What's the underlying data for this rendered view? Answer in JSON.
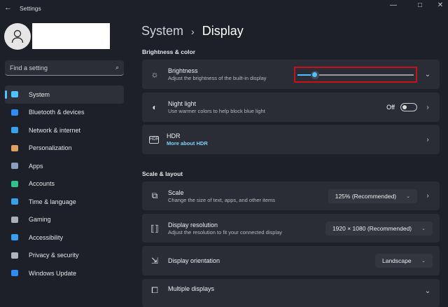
{
  "window": {
    "title": "Settings"
  },
  "search": {
    "placeholder": "Find a setting"
  },
  "nav": [
    {
      "label": "System",
      "icon": "monitor-icon",
      "color": "#4cc2ff"
    },
    {
      "label": "Bluetooth & devices",
      "icon": "bluetooth-icon",
      "color": "#2f8cf5"
    },
    {
      "label": "Network & internet",
      "icon": "wifi-icon",
      "color": "#3aa0e8"
    },
    {
      "label": "Personalization",
      "icon": "brush-icon",
      "color": "#e0a060"
    },
    {
      "label": "Apps",
      "icon": "apps-icon",
      "color": "#8aa0c0"
    },
    {
      "label": "Accounts",
      "icon": "person-icon",
      "color": "#2fc28a"
    },
    {
      "label": "Time & language",
      "icon": "globe-clock-icon",
      "color": "#3aa0e8"
    },
    {
      "label": "Gaming",
      "icon": "gamepad-icon",
      "color": "#aab0bb"
    },
    {
      "label": "Accessibility",
      "icon": "accessibility-icon",
      "color": "#3a9ef0"
    },
    {
      "label": "Privacy & security",
      "icon": "shield-icon",
      "color": "#b0b4bb"
    },
    {
      "label": "Windows Update",
      "icon": "update-icon",
      "color": "#2f8cf5"
    }
  ],
  "header": {
    "crumb": "System",
    "sep": "›",
    "title": "Display"
  },
  "sections": {
    "brightness": "Brightness & color",
    "scale": "Scale & layout"
  },
  "brightness": {
    "title": "Brightness",
    "subtitle": "Adjust the brightness of the built-in display",
    "value_percent": 15
  },
  "nightlight": {
    "title": "Night light",
    "subtitle": "Use warmer colors to help block blue light",
    "state": "Off"
  },
  "hdr": {
    "title": "HDR",
    "link": "More about HDR"
  },
  "scale": {
    "title": "Scale",
    "subtitle": "Change the size of text, apps, and other items",
    "value": "125% (Recommended)"
  },
  "resolution": {
    "title": "Display resolution",
    "subtitle": "Adjust the resolution to fit your connected display",
    "value": "1920 × 1080 (Recommended)"
  },
  "orientation": {
    "title": "Display orientation",
    "value": "Landscape"
  },
  "multiple": {
    "title": "Multiple displays"
  }
}
